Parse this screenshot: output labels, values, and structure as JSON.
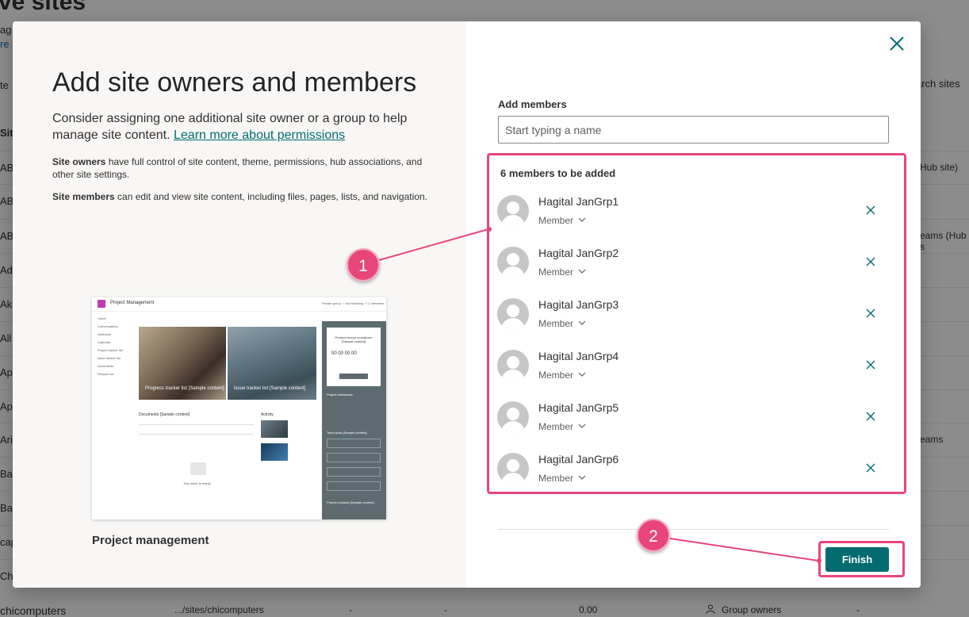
{
  "background": {
    "page_title": "ve sites",
    "sub_text": "ag",
    "link_text": "re a",
    "col_header": "Sit",
    "row_prefixes": [
      "AB",
      "AB",
      "AB",
      "Ad",
      "Ak",
      "All",
      "Ap",
      "Ap",
      "Ari",
      "Ba",
      "Ba",
      "cap",
      "Ch"
    ],
    "search_label": "arch sites",
    "right_cells": [
      "Hub site)",
      "eams (Hub s",
      "eams"
    ],
    "footer": {
      "site_name": "chicomputers",
      "url": ".../sites/chicomputers",
      "dash1": "-",
      "dash2": "-",
      "storage": "0.00",
      "owner_label": "Group owners",
      "dash3": "-"
    }
  },
  "modal": {
    "heading": "Add site owners and members",
    "description": "Consider assigning one additional site owner or a group to help manage site content.",
    "learn_more_link": "Learn more about permissions",
    "owners_term": "Site owners",
    "owners_text": "have full control of site content, theme, permissions, hub associations, and other site settings.",
    "members_term": "Site members",
    "members_text": "can edit and view site content, including files, pages, lists, and navigation.",
    "template_name": "Project management",
    "preview": {
      "site_title": "Project Management",
      "meta": "Private group  ☆ Not following  ⚇ 2 members",
      "nav": [
        "Home",
        "Conversations",
        "Notebook",
        "Calendar",
        "Project tracker list",
        "Issue tracker list",
        "Documents",
        "Recycle bin"
      ],
      "tile1": "Progress tracker list [Sample content]",
      "tile2": "Issue tracker list [Sample content]",
      "countdown_title": "Product launch countdown [Sample content]",
      "countdown": "00  00  00  00",
      "go_event": "Go to the event",
      "milestones": "Project milestones",
      "team_tools": "Team tools [Sample content]",
      "tools": [
        "Group",
        "Visual Studio",
        "Teams",
        "Whiteboard"
      ],
      "contacts": "Project contacts [Sample content]",
      "documents": "Documents [Sample content]",
      "activity": "Activity",
      "empty": "This folder is empty"
    },
    "add_members_label": "Add members",
    "input_placeholder": "Start typing a name",
    "members_count": "6 members to be added",
    "members": [
      {
        "name": "Hagital JanGrp1",
        "role": "Member"
      },
      {
        "name": "Hagital JanGrp2",
        "role": "Member"
      },
      {
        "name": "Hagital JanGrp3",
        "role": "Member"
      },
      {
        "name": "Hagital JanGrp4",
        "role": "Member"
      },
      {
        "name": "Hagital JanGrp5",
        "role": "Member"
      },
      {
        "name": "Hagital JanGrp6",
        "role": "Member"
      }
    ],
    "finish_label": "Finish"
  },
  "annotations": {
    "callout1": "1",
    "callout2": "2"
  },
  "colors": {
    "accent": "#036c70",
    "annotation": "#e8457a"
  },
  "icons": {
    "close": "close-icon",
    "chevron": "chevron-down-icon",
    "remove": "remove-icon",
    "avatar": "person-avatar-icon"
  }
}
